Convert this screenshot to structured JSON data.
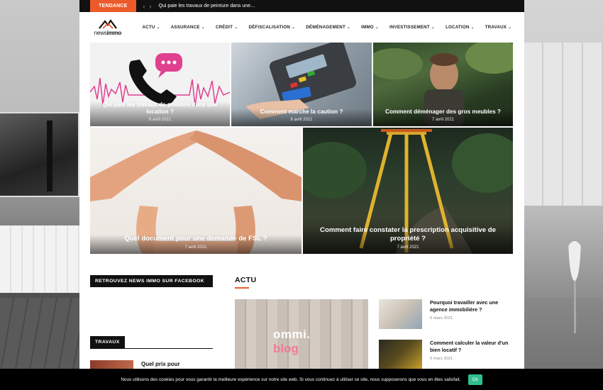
{
  "topbar": {
    "trending_label": "TENDANCE",
    "ticker_text": "Qui paie les travaux de peinture dans une…"
  },
  "logo": {
    "text_light": "news",
    "text_bold": "immo"
  },
  "nav": {
    "items": [
      {
        "label": "ACTU"
      },
      {
        "label": "ASSURANCE"
      },
      {
        "label": "CRÉDIT"
      },
      {
        "label": "DÉFISCALISATION"
      },
      {
        "label": "DÉMÉNAGEMENT"
      },
      {
        "label": "IMMO"
      },
      {
        "label": "INVESTISSEMENT"
      },
      {
        "label": "LOCATION"
      },
      {
        "label": "TRAVAUX"
      }
    ]
  },
  "featured": [
    {
      "title": "Qui paie les travaux de peinture dans une location ?",
      "date": "8 avril 2021"
    },
    {
      "title": "Comment marche la caution ?",
      "date": "8 avril 2021"
    },
    {
      "title": "Comment déménager des gros meubles ?",
      "date": "7 avril 2021"
    },
    {
      "title": "Quel document pour une demande de FSL ?",
      "date": "7 avril 2021"
    },
    {
      "title": "Comment faire constater la prescription acquisitive de propriété ?",
      "date": "7 avril 2021"
    }
  ],
  "sidebar": {
    "facebook_title": "RETROUVEZ NEWS IMMO SUR FACEBOOK",
    "travaux_title": "TRAVAUX",
    "travaux_first_post": "Quel prix pour"
  },
  "actu": {
    "section_title": "ACTU",
    "big_card_overlay_line1": "ommi.",
    "big_card_overlay_line2": "blog",
    "posts": [
      {
        "title": "Pourquoi travailler avec une agence immobilière ?",
        "date": "6 mars 2021"
      },
      {
        "title": "Comment calculer la valeur d'un bien locatif ?",
        "date": "6 mars 2021"
      }
    ]
  },
  "cookie": {
    "message": "Nous utilisons des cookies pour vous garantir la meilleure expérience sur notre site web. Si vous continuez à utiliser ce site, nous supposerons que vous en êtes satisfait.",
    "ok_label": "Ok"
  },
  "colors": {
    "accent": "#ec5a2a",
    "cookie_ok": "#2fbf8f",
    "topbar": "#111111"
  }
}
